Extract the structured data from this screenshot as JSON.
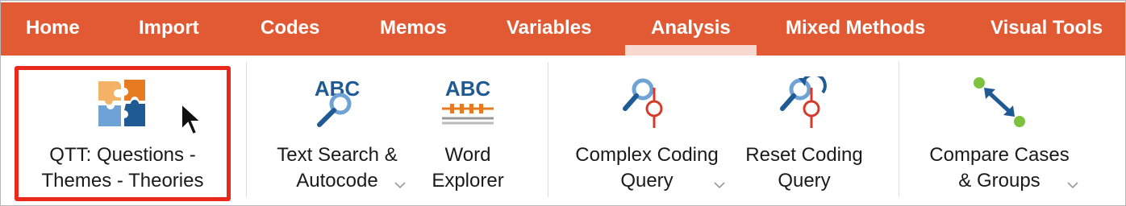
{
  "menubar": {
    "items": [
      {
        "label": "Home"
      },
      {
        "label": "Import"
      },
      {
        "label": "Codes"
      },
      {
        "label": "Memos"
      },
      {
        "label": "Variables"
      },
      {
        "label": "Analysis",
        "active": true
      },
      {
        "label": "Mixed Methods"
      },
      {
        "label": "Visual Tools"
      }
    ],
    "background_color": "#e25a33",
    "active_indicator_color": "#f7d9cf"
  },
  "ribbon": {
    "tools": [
      {
        "line1": "QTT: Questions -",
        "line2": "Themes - Theories",
        "icon": "puzzle-icon",
        "highlighted": true
      },
      {
        "line1": "Text Search &",
        "line2": "Autocode",
        "icon": "text-search-icon",
        "has_dropdown": true
      },
      {
        "line1": "Word",
        "line2": "Explorer",
        "icon": "word-explorer-icon"
      },
      {
        "line1": "Complex Coding",
        "line2": "Query",
        "icon": "complex-query-icon",
        "has_dropdown": true
      },
      {
        "line1": "Reset Coding",
        "line2": "Query",
        "icon": "reset-query-icon"
      },
      {
        "line1": "Compare Cases",
        "line2": "& Groups",
        "icon": "compare-cases-icon",
        "has_dropdown": true
      }
    ],
    "icon_text": "ABC",
    "highlight_color": "#e8291c"
  }
}
